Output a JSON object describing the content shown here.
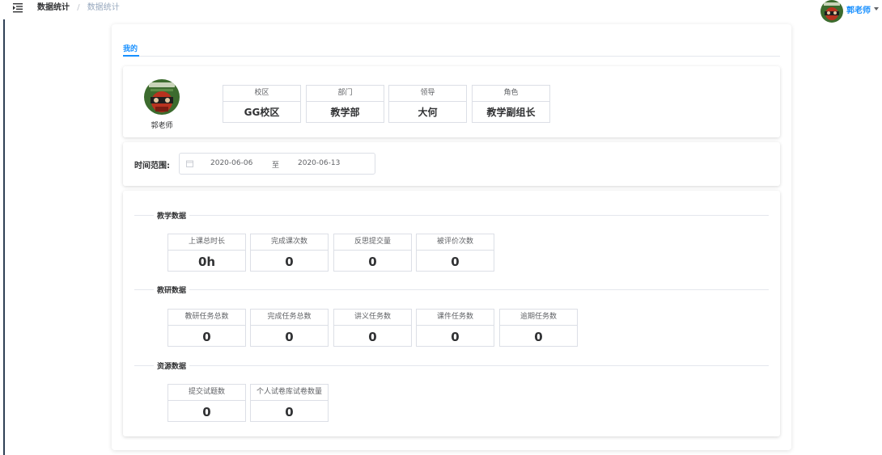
{
  "topbar": {
    "breadcrumb_main": "数据统计",
    "breadcrumb_sep": "/",
    "breadcrumb_sub": "数据统计",
    "username": "郭老师",
    "menu_icon": "hamburger-icon",
    "caret_icon": "caret-down-icon"
  },
  "tabs": [
    {
      "label": "我的",
      "active": true
    }
  ],
  "profile": {
    "name": "郭老师",
    "fields": [
      {
        "label": "校区",
        "value": "GG校区"
      },
      {
        "label": "部门",
        "value": "教学部"
      },
      {
        "label": "领导",
        "value": "大何"
      },
      {
        "label": "角色",
        "value": "教学副组长"
      }
    ]
  },
  "time_range": {
    "label": "时间范围:",
    "start": "2020-06-06",
    "separator": "至",
    "end": "2020-06-13",
    "icon": "calendar-icon"
  },
  "sections": [
    {
      "title": "教学数据",
      "stats": [
        {
          "label": "上课总时长",
          "value": "0h"
        },
        {
          "label": "完成课次数",
          "value": "0"
        },
        {
          "label": "反思提交量",
          "value": "0"
        },
        {
          "label": "被评价次数",
          "value": "0"
        }
      ]
    },
    {
      "title": "教研数据",
      "stats": [
        {
          "label": "教研任务总数",
          "value": "0"
        },
        {
          "label": "完成任务总数",
          "value": "0"
        },
        {
          "label": "讲义任务数",
          "value": "0"
        },
        {
          "label": "课件任务数",
          "value": "0"
        },
        {
          "label": "逾期任务数",
          "value": "0"
        }
      ]
    },
    {
      "title": "资源数据",
      "stats": [
        {
          "label": "提交试题数",
          "value": "0"
        },
        {
          "label": "个人试卷库试卷数量",
          "value": "0"
        }
      ]
    }
  ],
  "colors": {
    "accent": "#1890ff",
    "sidebar_line": "#304156",
    "border": "#dcdfe6"
  }
}
